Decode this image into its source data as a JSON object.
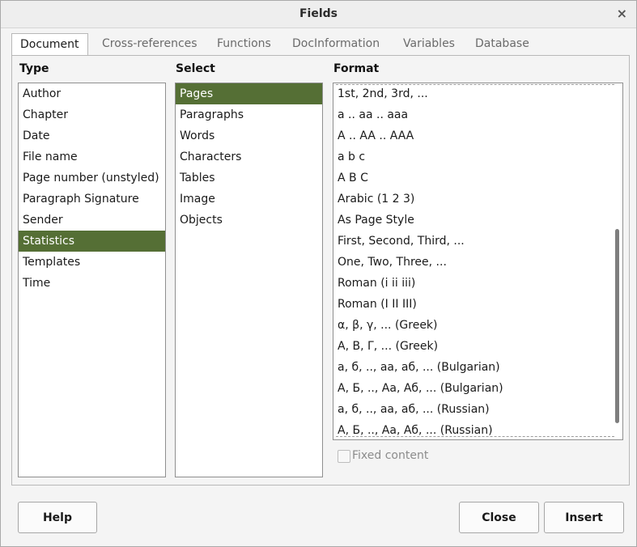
{
  "window": {
    "title": "Fields",
    "close_icon": "×"
  },
  "tabs": [
    {
      "label": "Document",
      "active": true
    },
    {
      "label": "Cross-references"
    },
    {
      "label": "Functions"
    },
    {
      "label": "DocInformation"
    },
    {
      "label": "Variables"
    },
    {
      "label": "Database"
    }
  ],
  "type": {
    "header": "Type",
    "items": [
      "Author",
      "Chapter",
      "Date",
      "File name",
      "Page number (unstyled)",
      "Paragraph Signature",
      "Sender",
      "Statistics",
      "Templates",
      "Time"
    ],
    "selected": "Statistics"
  },
  "select": {
    "header": "Select",
    "items": [
      "Pages",
      "Paragraphs",
      "Words",
      "Characters",
      "Tables",
      "Image",
      "Objects"
    ],
    "selected": "Pages"
  },
  "format": {
    "header": "Format",
    "items": [
      "1st, 2nd, 3rd, ...",
      "a .. aa .. aaa",
      "A .. AA .. AAA",
      "a b c",
      "A B C",
      "Arabic (1 2 3)",
      "As Page Style",
      "First, Second, Third, ...",
      "One, Two, Three, ...",
      "Roman (i ii iii)",
      "Roman (I II III)",
      "α, β, γ, ... (Greek)",
      "Α, Β, Γ, ... (Greek)",
      "а, б, .., аа, аб, ... (Bulgarian)",
      "А, Б, .., Аа, Аб, ... (Bulgarian)",
      "а, б, .., аа, аб, ... (Russian)",
      "А, Б, .., Аа, Аб, ... (Russian)"
    ]
  },
  "fixed_content": {
    "label": "Fixed content",
    "checked": false,
    "enabled": false
  },
  "buttons": {
    "help": "Help",
    "close": "Close",
    "insert": "Insert"
  },
  "colors": {
    "selection": "#556f35"
  }
}
